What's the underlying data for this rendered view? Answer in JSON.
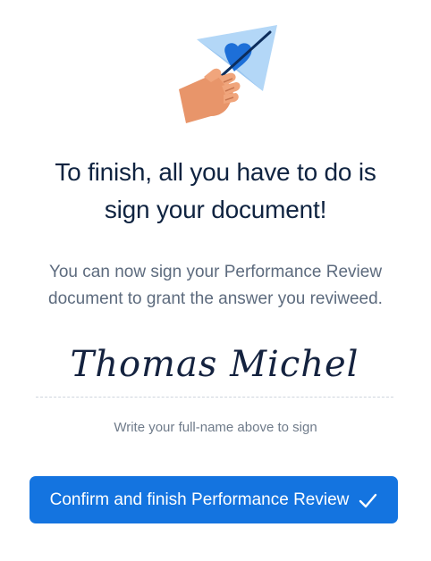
{
  "heading": {
    "line1": "To finish, all you have to do is",
    "line2": "sign your document!"
  },
  "subtext": {
    "line1": "You can now sign your Performance Review",
    "line2": "document to grant the answer you reviweed."
  },
  "signature": {
    "value": "Thomas Michel"
  },
  "hint": "Write your full-name above to sign",
  "confirm_button": {
    "label": "Confirm and finish Performance Review",
    "icon": "checkmark-icon"
  },
  "illustration": {
    "icon": "hand-holding-paper-plane-illustration"
  },
  "colors": {
    "primary": "#1474e0",
    "heading": "#0f2340",
    "text_muted": "#5d6b7e",
    "plane_light": "#a9d0f5",
    "plane_dark": "#1d6fd8",
    "skin": "#e8956a"
  }
}
